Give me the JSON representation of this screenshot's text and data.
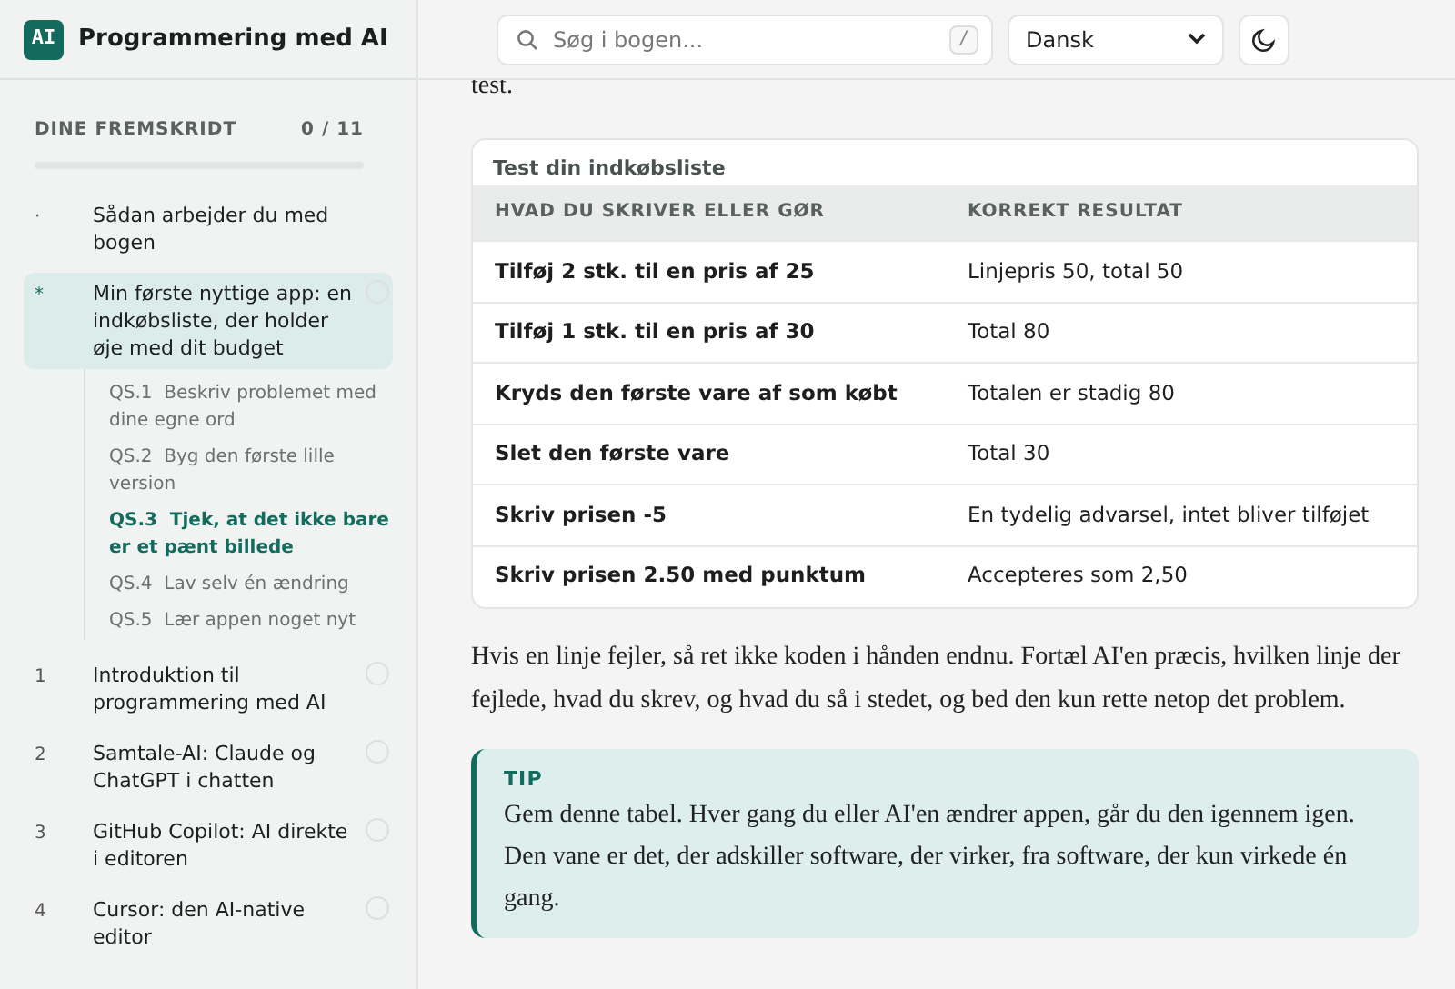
{
  "brand": {
    "logo": "AI",
    "title": "Programmering med AI"
  },
  "progress": {
    "label": "DINE FREMSKRIDT",
    "count": "0 / 11",
    "level": 0
  },
  "sidebar": {
    "items": [
      {
        "marker": "·",
        "label": "Sådan arbejder du med bogen",
        "selected": false
      },
      {
        "marker": "*",
        "label": "Min første nyttige app: en indkøbsliste, der holder øje med dit budget",
        "selected": true,
        "done": false,
        "children": [
          {
            "code": "QS.1",
            "label": "Beskriv problemet med dine egne ord",
            "selected": false
          },
          {
            "code": "QS.2",
            "label": "Byg den første lille version",
            "selected": false
          },
          {
            "code": "QS.3",
            "label": "Tjek, at det ikke bare er et pænt billede",
            "selected": true
          },
          {
            "code": "QS.4",
            "label": "Lav selv én ændring",
            "selected": false
          },
          {
            "code": "QS.5",
            "label": "Lær appen noget nyt",
            "selected": false
          }
        ]
      },
      {
        "marker": "1",
        "label": "Introduktion til programmering med AI",
        "selected": false,
        "done": false
      },
      {
        "marker": "2",
        "label": "Samtale-AI: Claude og ChatGPT i chatten",
        "selected": false,
        "done": false
      },
      {
        "marker": "3",
        "label": "GitHub Copilot: AI direkte i editoren",
        "selected": false,
        "done": false
      },
      {
        "marker": "4",
        "label": "Cursor: den AI-native editor",
        "selected": false,
        "done": false
      }
    ]
  },
  "topbar": {
    "search": {
      "placeholder": "Søg i bogen...",
      "shortcut": "/"
    },
    "language": "Dansk"
  },
  "content": {
    "lead_tail": "test.",
    "table": {
      "caption": "Test din indkøbsliste",
      "columns": [
        "HVAD DU SKRIVER ELLER GØR",
        "KORREKT RESULTAT"
      ],
      "rows": [
        [
          "Tilføj 2 stk. til en pris af 25",
          "Linjepris 50, total 50"
        ],
        [
          "Tilføj 1 stk. til en pris af 30",
          "Total 80"
        ],
        [
          "Kryds den første vare af som købt",
          "Totalen er stadig 80"
        ],
        [
          "Slet den første vare",
          "Total 30"
        ],
        [
          "Skriv prisen -5",
          "En tydelig advarsel, intet bliver tilføjet"
        ],
        [
          "Skriv prisen 2.50 med punktum",
          "Accepteres som 2,50"
        ]
      ]
    },
    "paragraph": "Hvis en linje fejler, så ret ikke koden i hånden endnu. Fortæl AI'en præcis, hvilken linje der fejlede, hvad du skrev, og hvad du så i stedet, og bed den kun rette netop det problem.",
    "tip": {
      "label": "TIP",
      "text": "Gem denne tabel. Hver gang du eller AI'en ændrer appen, går du den igennem igen. Den vane er det, der adskiller software, der virker, fra software, der kun virkede én gang."
    }
  }
}
